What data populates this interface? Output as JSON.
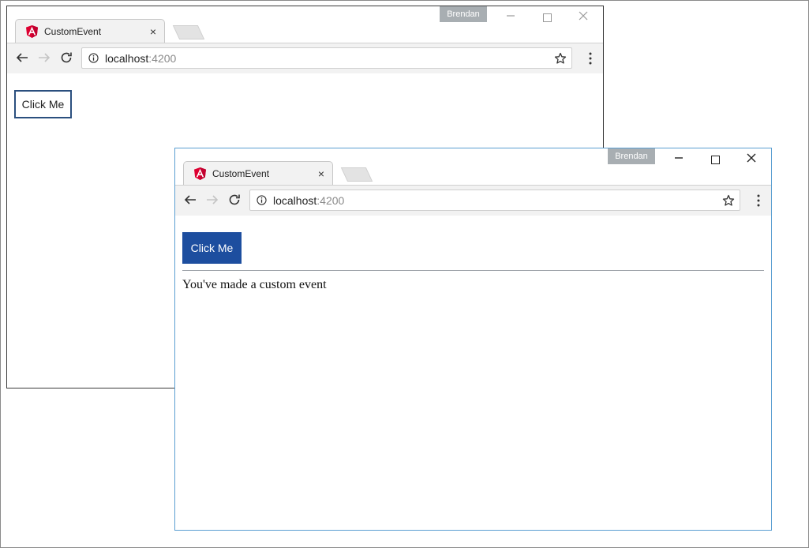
{
  "windows": {
    "back": {
      "tab_title": "CustomEvent",
      "tab_close": "×",
      "profile": "Brendan",
      "url_host": "localhost",
      "url_port": ":4200",
      "button_label": "Click Me"
    },
    "front": {
      "tab_title": "CustomEvent",
      "tab_close": "×",
      "profile": "Brendan",
      "url_host": "localhost",
      "url_port": ":4200",
      "button_label": "Click Me",
      "message": "You've made a custom event"
    }
  },
  "icons": {
    "tab_favicon": "angular-icon",
    "back": "arrow-left-icon",
    "forward": "arrow-right-icon",
    "reload": "reload-icon",
    "site_info": "info-icon",
    "bookmark": "star-icon",
    "menu": "kebab-menu-icon",
    "minimize": "minimize-icon",
    "maximize": "maximize-icon",
    "close": "close-icon"
  },
  "colors": {
    "angular_red": "#dd0031",
    "button_primary": "#1d4e9f",
    "button_outline": "#2b4f7e",
    "window_focus_border": "#5b9fd1",
    "profile_badge": "#a8aeb2"
  }
}
